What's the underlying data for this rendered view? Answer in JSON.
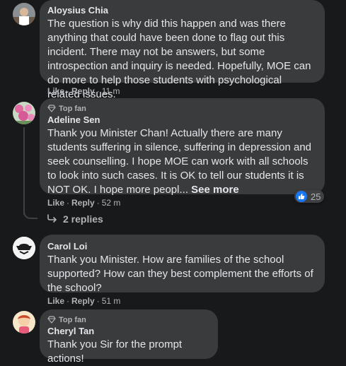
{
  "comments": [
    {
      "name": "Aloysius Chia",
      "top_fan": false,
      "text": "The question is why did this happen and was there anything that could have been done to flag out this incident. There may not be answers, but some introspection and inquiry is needed. Hopefully, MOE can do more to help those students with psychological related issues.",
      "like_label": "Like",
      "reply_label": "Reply",
      "time": "11 m"
    },
    {
      "name": "Adeline Sen",
      "top_fan": true,
      "top_fan_label": "Top fan",
      "text": "Thank you Minister Chan! Actually there are many students suffering in silence, suffering in depression and seek counselling. I hope MOE can work with all schools to look into such cases. It is OK to tell our students it is NOT OK. I hope more peopl...",
      "see_more": "See more",
      "like_label": "Like",
      "reply_label": "Reply",
      "time": "52 m",
      "reaction_count": "25",
      "replies_label": "2 replies"
    },
    {
      "name": "Carol Loi",
      "top_fan": false,
      "text": "Thank you Minister. How are families of the school supported? How can they best complement the efforts of the school?",
      "like_label": "Like",
      "reply_label": "Reply",
      "time": "51 m"
    },
    {
      "name": "Cheryl Tan",
      "top_fan": true,
      "top_fan_label": "Top fan",
      "text": "Thank you Sir for the prompt actions!"
    }
  ],
  "separator": "·",
  "colors": {
    "background": "#18191a",
    "bubble": "#3a3b3c",
    "text": "#e4e6eb",
    "secondary": "#b0b3b8",
    "like_blue": "#1877f2"
  },
  "icons": {
    "top_fan": "diamond-icon",
    "reaction": "thumbs-up-icon",
    "replies": "reply-arrow-icon"
  }
}
